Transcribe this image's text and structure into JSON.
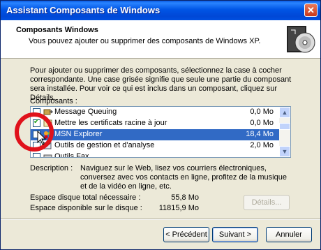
{
  "window": {
    "title": "Assistant Composants de Windows",
    "close_glyph": "✕"
  },
  "header": {
    "title": "Composants Windows",
    "subtitle": "Vous pouvez ajouter ou supprimer des composants de Windows XP.",
    "icon": "cd-box-icon"
  },
  "instructions": "Pour ajouter ou supprimer des composants, sélectionnez la case à cocher correspondante. Une case grisée signifie que seule une partie du composant sera installée. Pour voir ce qui est inclus dans un composant, cliquez sur Détails.",
  "components": {
    "label": "Composants :",
    "items": [
      {
        "name": "Message Queuing",
        "size": "0,0 Mo",
        "checked": false,
        "selected": false,
        "icon": "message-queue-icon"
      },
      {
        "name": "Mettre les certificats racine à jour",
        "size": "0,0 Mo",
        "checked": true,
        "selected": false,
        "icon": "certificate-icon"
      },
      {
        "name": "MSN Explorer",
        "size": "18,4 Mo",
        "checked": false,
        "selected": true,
        "icon": "msn-butterfly-icon"
      },
      {
        "name": "Outils de gestion et d'analyse",
        "size": "2,0 Mo",
        "checked": false,
        "selected": false,
        "icon": "tools-icon"
      },
      {
        "name": "Outils Fax",
        "size": "",
        "checked": false,
        "selected": false,
        "icon": "fax-icon"
      }
    ]
  },
  "description": {
    "label": "Description :",
    "text": "Naviguez sur le Web, lisez vos courriers électroniques, conversez avec vos contacts en ligne, profitez de la musique et de la vidéo en ligne, etc."
  },
  "disk": {
    "required_label": "Espace disque total nécessaire :",
    "required_value": "55,8 Mo",
    "available_label": "Espace disponible sur le disque :",
    "available_value": "11815,9 Mo"
  },
  "buttons": {
    "details": "Détails...",
    "back": "< Précédent",
    "next": "Suivant >",
    "cancel": "Annuler"
  },
  "colors": {
    "titlebar": "#0055e5",
    "selection": "#316ac5",
    "highlight_circle": "#e0121b"
  }
}
